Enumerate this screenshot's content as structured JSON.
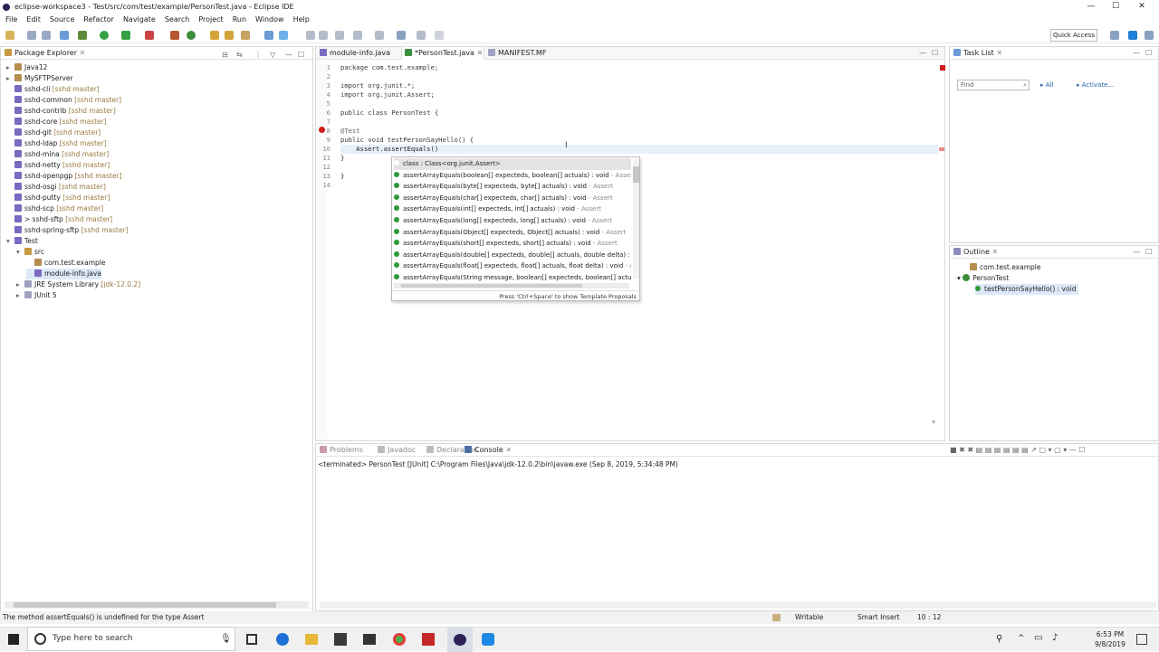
{
  "window": {
    "title": "eclipse-workspace3 - Test/src/com/test/example/PersonTest.java - Eclipse IDE",
    "min": "—",
    "max": "☐",
    "close": "✕"
  },
  "menu": [
    "File",
    "Edit",
    "Source",
    "Refactor",
    "Navigate",
    "Search",
    "Project",
    "Run",
    "Window",
    "Help"
  ],
  "quick_access": "Quick Access",
  "package_explorer": {
    "title": "Package Explorer",
    "items": [
      {
        "label": "Java12",
        "extra": ""
      },
      {
        "label": "MySFTPServer",
        "extra": ""
      },
      {
        "label": "sshd-cli",
        "extra": "[sshd master]"
      },
      {
        "label": "sshd-common",
        "extra": "[sshd master]"
      },
      {
        "label": "sshd-contrib",
        "extra": "[sshd master]"
      },
      {
        "label": "sshd-core",
        "extra": "[sshd master]"
      },
      {
        "label": "sshd-git",
        "extra": "[sshd master]"
      },
      {
        "label": "sshd-ldap",
        "extra": "[sshd master]"
      },
      {
        "label": "sshd-mina",
        "extra": "[sshd master]"
      },
      {
        "label": "sshd-netty",
        "extra": "[sshd master]"
      },
      {
        "label": "sshd-openpgp",
        "extra": "[sshd master]"
      },
      {
        "label": "sshd-osgi",
        "extra": "[sshd master]"
      },
      {
        "label": "sshd-putty",
        "extra": "[sshd master]"
      },
      {
        "label": "sshd-scp",
        "extra": "[sshd master]"
      },
      {
        "label": "> sshd-sftp",
        "extra": "[sshd master]"
      },
      {
        "label": "sshd-spring-sftp",
        "extra": "[sshd master]"
      },
      {
        "label": "Test",
        "extra": ""
      },
      {
        "label": "src",
        "extra": ""
      },
      {
        "label": "com.test.example",
        "extra": ""
      },
      {
        "label": "module-info.java",
        "extra": ""
      },
      {
        "label": "JRE System Library",
        "extra": "[jdk-12.0.2]"
      },
      {
        "label": "JUnit 5",
        "extra": ""
      }
    ]
  },
  "editor": {
    "tabs": [
      "module-info.java",
      "*PersonTest.java",
      "MANIFEST.MF"
    ],
    "lines": [
      {
        "n": "1",
        "t": "package com.test.example;"
      },
      {
        "n": "2",
        "t": ""
      },
      {
        "n": "3",
        "t": "import org.junit.*;"
      },
      {
        "n": "4",
        "t": "import org.junit.Assert;"
      },
      {
        "n": "5",
        "t": ""
      },
      {
        "n": "6",
        "t": "public class PersonTest {"
      },
      {
        "n": "7",
        "t": ""
      },
      {
        "n": "8",
        "t": "@Test"
      },
      {
        "n": "9",
        "t": "public void testPersonSayHello() {"
      },
      {
        "n": "10",
        "t": "    Assert.assertEquals()"
      },
      {
        "n": "11",
        "t": "}"
      },
      {
        "n": "12",
        "t": ""
      },
      {
        "n": "13",
        "t": "}"
      },
      {
        "n": "14",
        "t": ""
      }
    ]
  },
  "completion": {
    "items": [
      {
        "t": "class : Class<org.junit.Assert>",
        "q": ""
      },
      {
        "t": "assertArrayEquals(boolean[] expecteds, boolean[] actuals) : void",
        "q": " - Asser"
      },
      {
        "t": "assertArrayEquals(byte[] expecteds, byte[] actuals) : void",
        "q": " - Assert"
      },
      {
        "t": "assertArrayEquals(char[] expecteds, char[] actuals) : void",
        "q": " - Assert"
      },
      {
        "t": "assertArrayEquals(int[] expecteds, int[] actuals) : void",
        "q": " - Assert"
      },
      {
        "t": "assertArrayEquals(long[] expecteds, long[] actuals) : void",
        "q": " - Assert"
      },
      {
        "t": "assertArrayEquals(Object[] expecteds, Object[] actuals) : void",
        "q": " - Assert"
      },
      {
        "t": "assertArrayEquals(short[] expecteds, short[] actuals) : void",
        "q": " - Assert"
      },
      {
        "t": "assertArrayEquals(double[] expecteds, double[] actuals, double delta) : v",
        "q": ""
      },
      {
        "t": "assertArrayEquals(float[] expecteds, float[] actuals, float delta) : void",
        "q": " - A"
      },
      {
        "t": "assertArrayEquals(String message, boolean[] expecteds, boolean[] actua",
        "q": ""
      }
    ],
    "hint": "Press 'Ctrl+Space' to show Template Proposals"
  },
  "task_list": {
    "title": "Task List",
    "find": "Find",
    "all": "All",
    "activate": "Activate..."
  },
  "outline": {
    "title": "Outline",
    "items": [
      "com.test.example",
      "PersonTest",
      "testPersonSayHello() : void"
    ]
  },
  "bottom": {
    "tabs": [
      "Problems",
      "Javadoc",
      "Declaration",
      "Console"
    ],
    "console_line": "<terminated> PersonTest [JUnit] C:\\Program Files\\Java\\jdk-12.0.2\\bin\\javaw.exe (Sep 8, 2019, 5:34:48 PM)"
  },
  "status": {
    "message": "The method assertEquals() is undefined for the type Assert",
    "writable": "Writable",
    "insert": "Smart Insert",
    "pos": "10 : 12"
  },
  "taskbar": {
    "search": "Type here to search",
    "time": "6:53 PM",
    "date": "9/8/2019"
  },
  "colors": {
    "accent": "#1e7fd6",
    "keyword": "#7f0055",
    "error": "#d11a1a"
  }
}
